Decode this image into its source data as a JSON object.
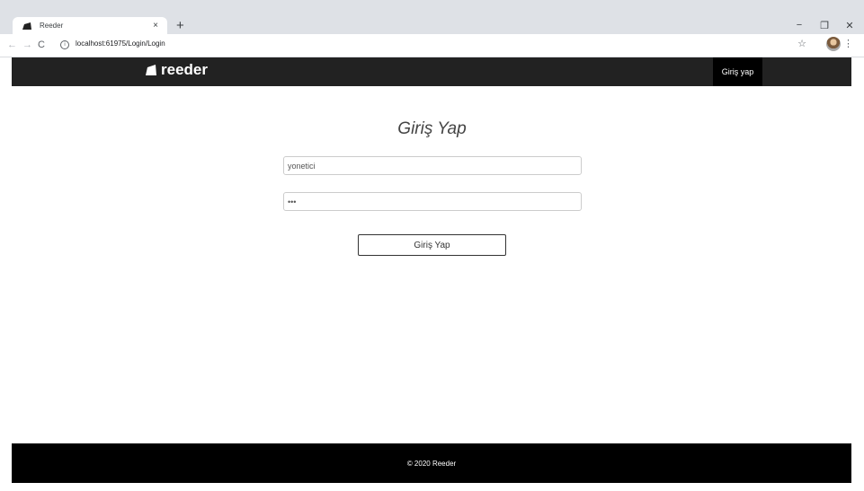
{
  "browser": {
    "tab_title": "Reeder",
    "tab_close": "×",
    "new_tab": "+",
    "url": "localhost:61975/Login/Login",
    "controls": {
      "minimize": "−",
      "restore": "❐",
      "close": "✕"
    },
    "nav": {
      "back": "←",
      "forward": "→",
      "reload": "C"
    },
    "info": "i",
    "star": "☆",
    "menu": "⋮"
  },
  "header": {
    "brand": "reeder",
    "login_link": "Giriş yap"
  },
  "main": {
    "title": "Giriş Yap",
    "username_value": "yonetici",
    "password_value": "•••",
    "submit_label": "Giriş Yap"
  },
  "footer": {
    "text": "© 2020 Reeder"
  },
  "colors": {
    "header_bg": "#222222",
    "footer_bg": "#000000",
    "tabbar_bg": "#dee1e6"
  },
  "icons": {
    "favicon": "reeder-logo-icon",
    "brand": "reeder-logo-icon"
  }
}
